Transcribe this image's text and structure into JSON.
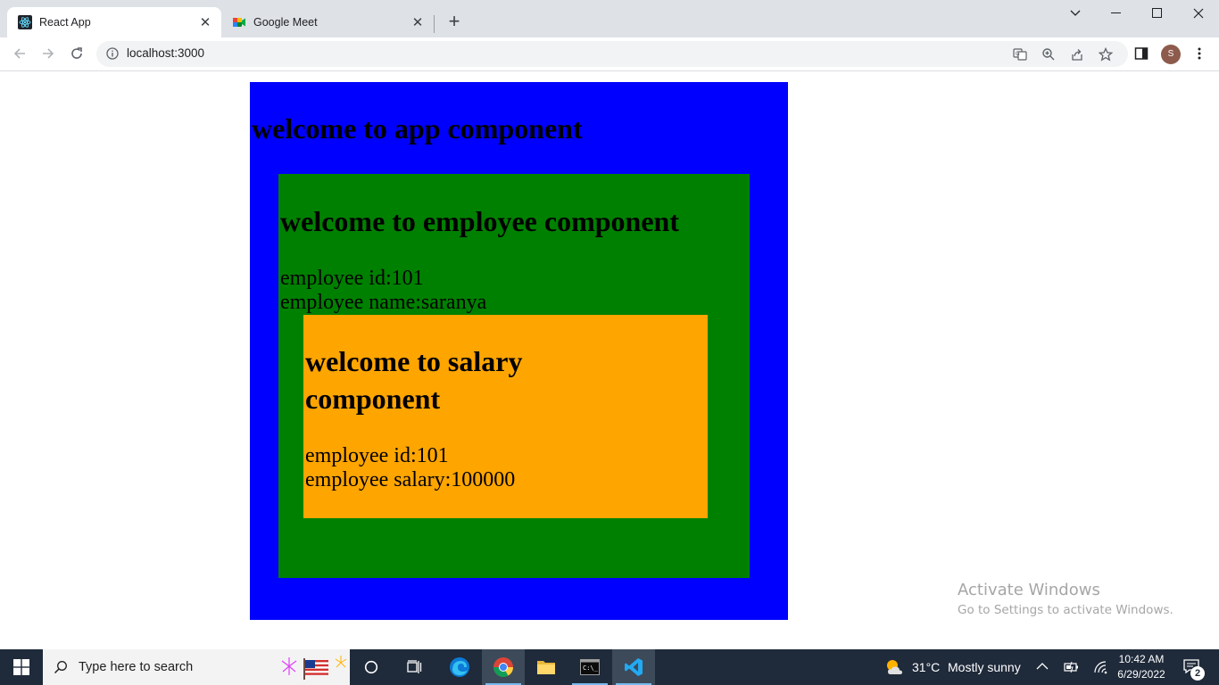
{
  "browser": {
    "tabs": [
      {
        "title": "React App",
        "active": true
      },
      {
        "title": "Google Meet",
        "active": false
      }
    ],
    "url": "localhost:3000",
    "profile_initial": "S"
  },
  "page": {
    "app": {
      "heading": "welcome to app component",
      "color": "#0000ff"
    },
    "employee": {
      "heading": "welcome to employee component",
      "id_line": "employee id:101",
      "name_line": "employee name:saranya",
      "color": "#008000"
    },
    "salary": {
      "heading_line1": "welcome to salary",
      "heading_line2": "component",
      "id_line": "employee id:101",
      "salary_line": "employee salary:100000",
      "color": "#ffa500"
    }
  },
  "watermark": {
    "title": "Activate Windows",
    "subtitle": "Go to Settings to activate Windows."
  },
  "taskbar": {
    "search_placeholder": "Type here to search",
    "weather": {
      "temp": "31°C",
      "condition": "Mostly sunny"
    },
    "time": "10:42 AM",
    "date": "6/29/2022",
    "notification_count": "2"
  }
}
